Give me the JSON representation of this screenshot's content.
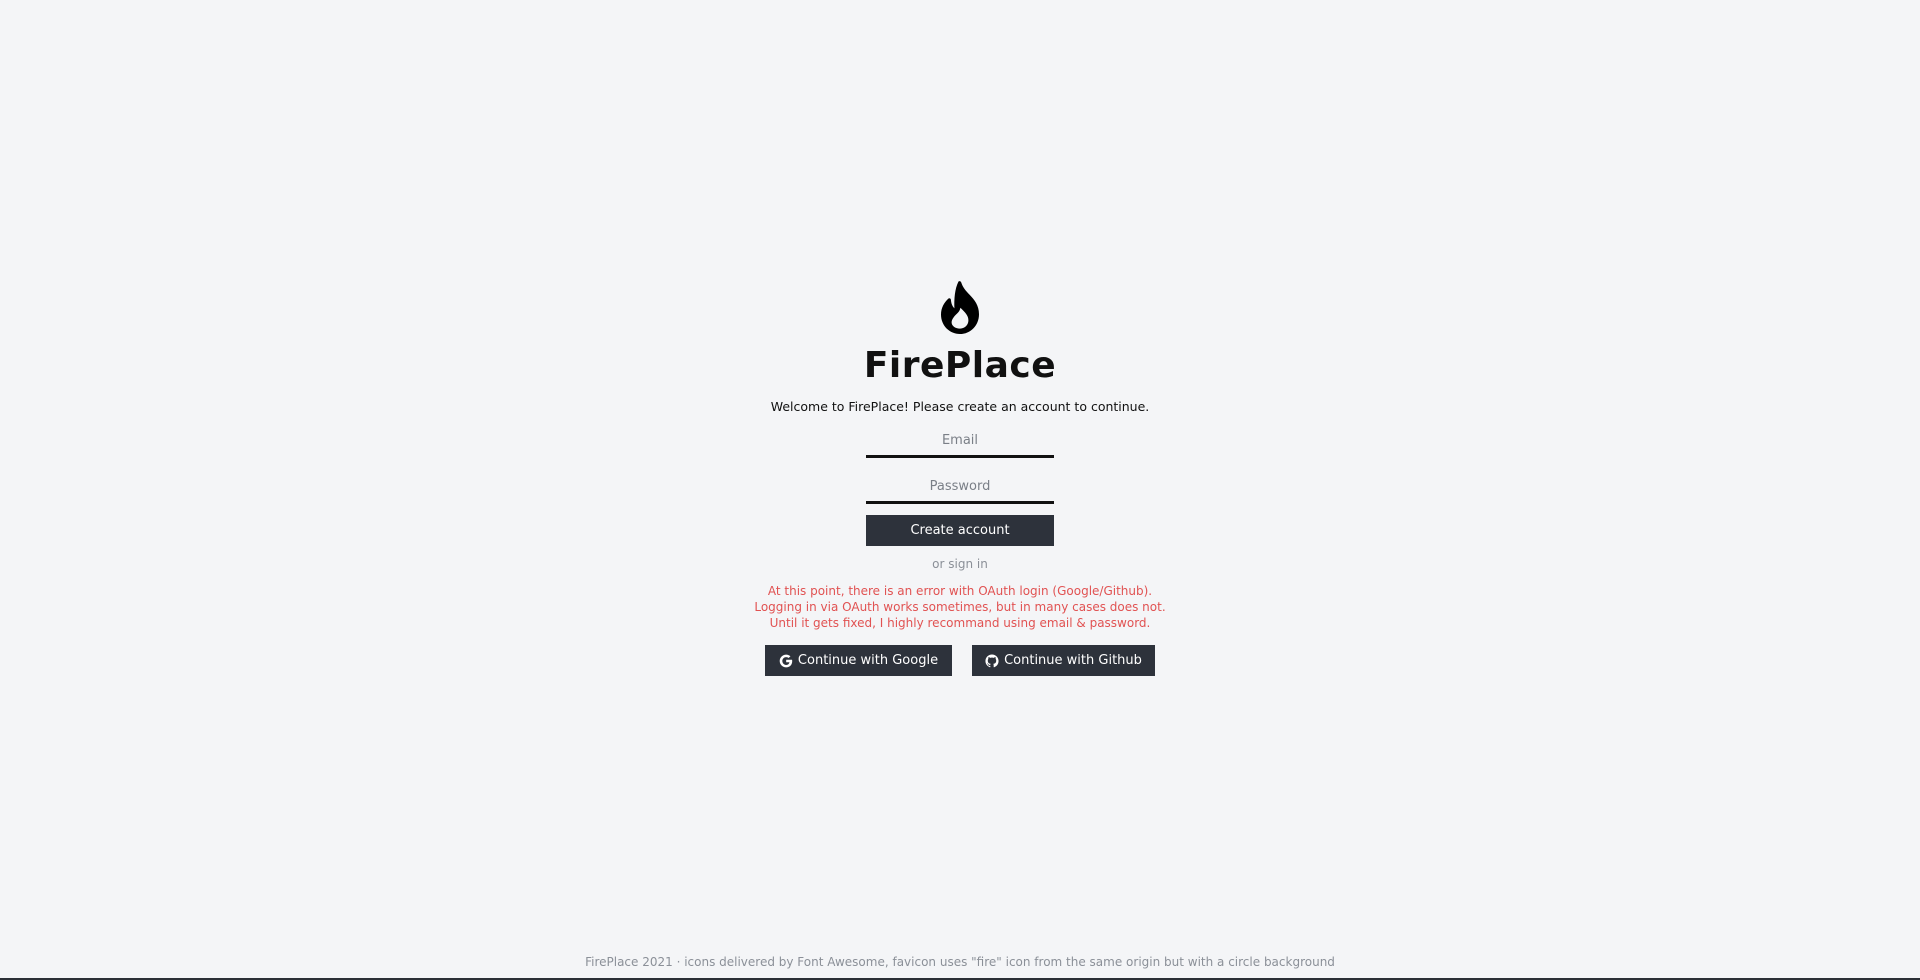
{
  "brand": {
    "title": "FirePlace",
    "logo_icon": "fire-icon"
  },
  "welcome_text": "Welcome to FirePlace! Please create an account to continue.",
  "form": {
    "email_placeholder": "Email",
    "password_placeholder": "Password",
    "create_account_label": "Create account",
    "or_sign_in": "or sign in"
  },
  "error": {
    "line1": "At this point, there is an error with OAuth login (Google/Github).",
    "line2": "Logging in via OAuth works sometimes, but in many cases does not.",
    "line3": "Until it gets fixed, I highly recommand using email & password."
  },
  "oauth": {
    "google_label": "Continue with Google",
    "google_icon": "google-icon",
    "github_label": "Continue with Github",
    "github_icon": "github-icon"
  },
  "footer": {
    "text": "FirePlace 2021 · icons delivered by Font Awesome, favicon uses \"fire\" icon from the same origin but with a circle background"
  },
  "colors": {
    "background": "#f4f5f7",
    "button": "#2d323b",
    "error": "#e15252",
    "muted": "#8b9098"
  }
}
